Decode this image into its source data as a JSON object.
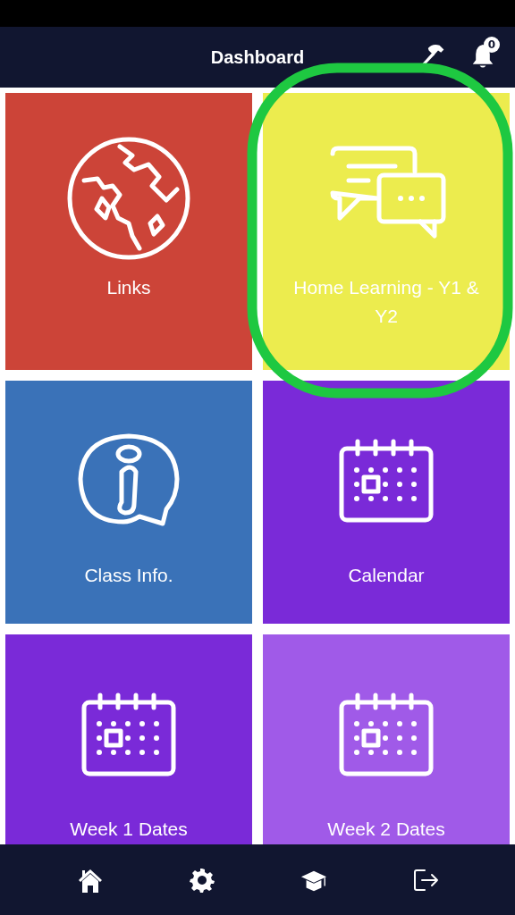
{
  "header": {
    "title": "Dashboard",
    "notification_count": "0"
  },
  "tiles": [
    {
      "label": "Links",
      "kind": "globe",
      "color": "#cc4438",
      "highlighted": false
    },
    {
      "label": "Home Learning - Y1 & Y2",
      "kind": "chat",
      "color": "#ecec4e",
      "highlighted": true
    },
    {
      "label": "Class Info.",
      "kind": "info",
      "color": "#3a72b8",
      "highlighted": false
    },
    {
      "label": "Calendar",
      "kind": "calendar",
      "color": "#7a2ad8",
      "highlighted": false
    },
    {
      "label": "Week 1 Dates",
      "kind": "calendar",
      "color": "#7a2ad8",
      "highlighted": false
    },
    {
      "label": "Week 2 Dates",
      "kind": "calendar",
      "color": "#a05ae8",
      "highlighted": false
    }
  ]
}
